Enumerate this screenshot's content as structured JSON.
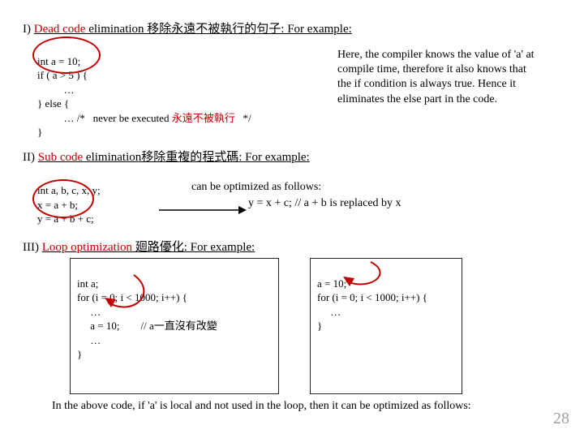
{
  "sec1": {
    "head_num": "I) ",
    "head_red": "Dead code",
    "head_rest": " elimination 移除永遠不被執行的句子: For example:",
    "code_l1": "int a = 10;",
    "code_l2": "if ( a > 5 ) {",
    "code_l3": "          …",
    "code_l4": "} else {",
    "code_l5": "          … /*   never be executed ",
    "code_l5_red": "永遠不被執行",
    "code_l5_end": "   */",
    "code_l6": "}",
    "explain": "Here, the compiler knows the value of 'a' at compile time, therefore it also knows that the if condition is always true. Hence it eliminates the else part in the code."
  },
  "sec2": {
    "head_num": "II) ",
    "head_red": "Sub code",
    "head_rest": " elimination移除重複的程式碼: For example:",
    "code_l1": "int a, b, c, x, y;",
    "code_l2": "x = a + b;",
    "code_l3": "y = a + b + c;",
    "opt_label": "can be optimized as follows:",
    "result": "y = x + c;      // a + b is replaced by x"
  },
  "sec3": {
    "head_num": "III) ",
    "head_red": "Loop optimization",
    "head_rest": " 廻路優化: For example:",
    "left_l1": "int a;",
    "left_l2": "for (i = 0; i < 1000; i++) {",
    "left_l3": "     …",
    "left_l4": "     a = 10;",
    "left_comment": "// a一直沒有改變",
    "left_l5": "     …",
    "left_l6": "}",
    "right_l1": "a = 10;",
    "right_l2": "for (i = 0; i < 1000; i++) {",
    "right_l3": "     …",
    "right_l4": "}",
    "note": "In the above code, if 'a' is local and not used in the loop, then it can be optimized as follows:"
  },
  "slidenum": "28"
}
